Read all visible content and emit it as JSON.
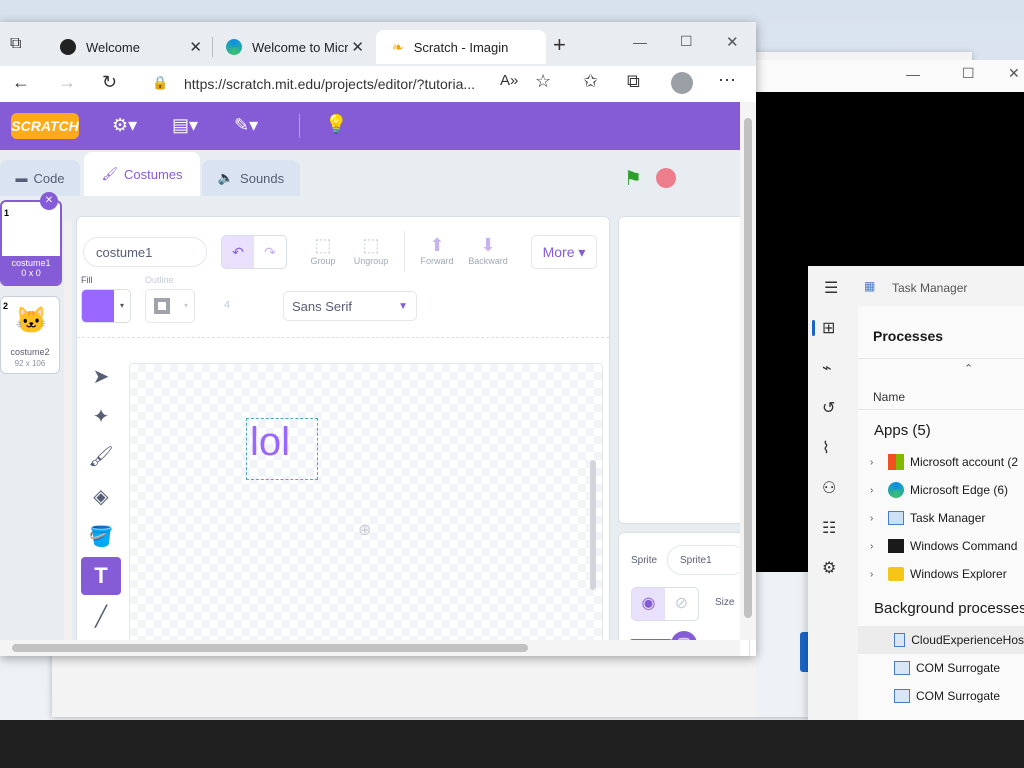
{
  "browser": {
    "tabs": [
      {
        "label": "Welcome",
        "icon": "edge-dev-icon"
      },
      {
        "label": "Welcome to Micr",
        "icon": "edge-icon"
      },
      {
        "label": "Scratch - Imagin",
        "icon": "scratch-icon"
      }
    ],
    "url": "https://scratch.mit.edu/projects/editor/?tutoria..."
  },
  "scratch": {
    "logo": "SCRATCH",
    "tabs": {
      "code": "Code",
      "costumes": "Costumes",
      "sounds": "Sounds"
    },
    "costumes": [
      {
        "index": "1",
        "name": "costume1",
        "size": "0 x 0"
      },
      {
        "index": "2",
        "name": "costume2",
        "size": "92 x 106"
      }
    ],
    "editor": {
      "costume_name": "costume1",
      "group": "Group",
      "ungroup": "Ungroup",
      "forward": "Forward",
      "backward": "Backward",
      "more": "More",
      "fill": "Fill",
      "outline": "Outline",
      "outline_width": "4",
      "font": "Sans Serif",
      "canvas_text": "lol",
      "fill_color": "#9966ff"
    },
    "sprite": {
      "label": "Sprite",
      "name": "Sprite1",
      "size_label": "Size"
    }
  },
  "taskmanager": {
    "title": "Task Manager",
    "section": "Processes",
    "column": "Name",
    "apps_header": "Apps (5)",
    "apps": [
      {
        "name": "Microsoft account (2",
        "icon": "microsoft-icon"
      },
      {
        "name": "Microsoft Edge (6)",
        "icon": "edge-icon"
      },
      {
        "name": "Task Manager",
        "icon": "taskmanager-icon"
      },
      {
        "name": "Windows Command",
        "icon": "cmd-icon"
      },
      {
        "name": "Windows Explorer",
        "icon": "folder-icon"
      }
    ],
    "bg_header": "Background processes",
    "bg": [
      {
        "name": "CloudExperienceHos"
      },
      {
        "name": "COM Surrogate"
      },
      {
        "name": "COM Surrogate"
      }
    ]
  },
  "colors": {
    "scratch_purple": "#855cd6",
    "accent_blue": "#1a67c9"
  }
}
